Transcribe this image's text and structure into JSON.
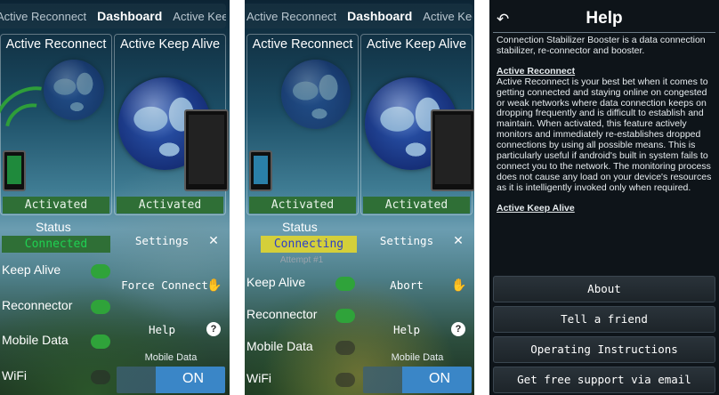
{
  "screens": [
    {
      "tabs": [
        "Active Reconnect",
        "Dashboard",
        "Active Keep Alive"
      ],
      "left_col": {
        "title": "Active Reconnect",
        "state": "Activated"
      },
      "right_col": {
        "title": "Active Keep Alive",
        "state": "Activated"
      },
      "status": {
        "label": "Status",
        "value": "Connected",
        "value_color": "#19c44a",
        "attempt": ""
      },
      "toggles": [
        {
          "label": "Keep Alive",
          "on": true
        },
        {
          "label": "Reconnector",
          "on": true
        },
        {
          "label": "Mobile Data",
          "on": true
        },
        {
          "label": "WiFi",
          "on": false
        }
      ],
      "buttons": [
        {
          "label": "Settings",
          "icon": "tools-icon"
        },
        {
          "label": "Force Connect",
          "icon": "hand-icon"
        },
        {
          "label": "Help",
          "icon": "question-icon"
        }
      ],
      "mobile_data": {
        "label": "Mobile Data",
        "value": "ON"
      }
    },
    {
      "tabs": [
        "Active Reconnect",
        "Dashboard",
        "Active Keep Alive"
      ],
      "left_col": {
        "title": "Active Reconnect",
        "state": "Activated"
      },
      "right_col": {
        "title": "Active Keep Alive",
        "state": "Activated"
      },
      "status": {
        "label": "Status",
        "value": "Connecting",
        "value_color": "#2b3fc8",
        "attempt": "Attempt #1"
      },
      "toggles": [
        {
          "label": "Keep Alive",
          "on": true
        },
        {
          "label": "Reconnector",
          "on": true
        },
        {
          "label": "Mobile Data",
          "on": false
        },
        {
          "label": "WiFi",
          "on": false
        }
      ],
      "buttons": [
        {
          "label": "Settings",
          "icon": "tools-icon"
        },
        {
          "label": "Abort",
          "icon": "hand-icon"
        },
        {
          "label": "Help",
          "icon": "question-icon"
        }
      ],
      "mobile_data": {
        "label": "Mobile Data",
        "value": "ON"
      }
    }
  ],
  "help": {
    "title": "Help",
    "intro": "Connection Stabilizer Booster is a data connection stabilizer, re-connector and booster.",
    "section1_title": "Active Reconnect",
    "section1_text": "Active Reconnect is your best bet when it comes to getting connected and staying online on congested or weak networks where data connection keeps on dropping frequently and is difficult to establish and maintain. When activated, this feature actively monitors and immediately re-establishes dropped connections by using all possible means. This is particularly useful if android's built in system fails to connect you to the network. The monitoring process does not cause any load on your device's resources as it is intelligently invoked only when required.",
    "section2_title": "Active Keep Alive",
    "buttons": [
      "About",
      "Tell a friend",
      "Operating Instructions",
      "Get free support via email"
    ]
  },
  "colors": {
    "activated_bar": "#2f6f36",
    "toggle_on": "#2fa33a",
    "on_bar": "#3a86c7",
    "connecting_bg": "#d4cf3a"
  }
}
